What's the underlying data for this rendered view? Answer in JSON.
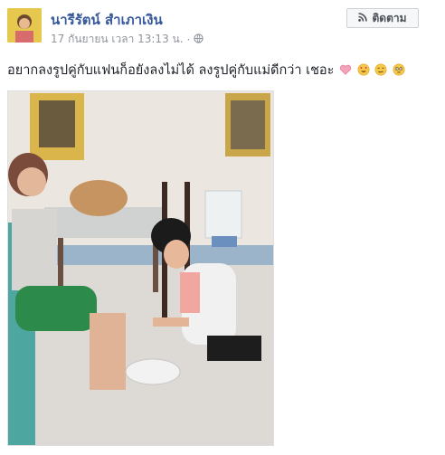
{
  "post": {
    "author": "นารีรัตน์ สำเภาเงิน",
    "timestamp": "17 กันยายน เวลา 13:13 น.",
    "separator": "·",
    "privacy_icon": "globe-icon",
    "text": "อยากลงรูปคู่กับแฟนก็อยังลงไม่ได้ ลงรูปคู่กับแม่ดีกว่า เชอะ",
    "emojis": [
      "heart-emoji",
      "heart-eyes-emoji",
      "smirk-emoji",
      "flushed-emoji"
    ]
  },
  "follow": {
    "label": "ติดตาม",
    "icon": "rss-icon"
  },
  "colors": {
    "link": "#365899",
    "meta": "#90949c",
    "text": "#1d2129",
    "button_bg": "#f6f7f9",
    "button_border": "#ced0d4"
  }
}
